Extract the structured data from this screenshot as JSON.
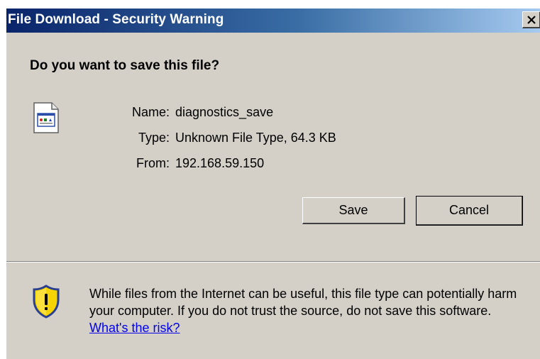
{
  "dialog": {
    "title": "File Download - Security Warning",
    "close_symbol": "X",
    "heading": "Do you want to save this file?",
    "file": {
      "name_label": "Name:",
      "name_value": "diagnostics_save",
      "type_label": "Type:",
      "type_value": "Unknown File Type, 64.3 KB",
      "from_label": "From:",
      "from_value": "192.168.59.150",
      "icon": "file-icon"
    },
    "buttons": {
      "save_label": "Save",
      "cancel_label": "Cancel"
    },
    "warning": {
      "text": "While files from the Internet can be useful, this file type can potentially harm your computer. If you do not trust the source, do not save this software. ",
      "link_text": "What's the risk?",
      "icon": "shield-warning-icon"
    }
  },
  "colors": {
    "dialog_bg": "#d4d0c8",
    "title_gradient_start": "#0a246a",
    "title_gradient_end": "#a6caf0",
    "link": "#0000ee"
  }
}
